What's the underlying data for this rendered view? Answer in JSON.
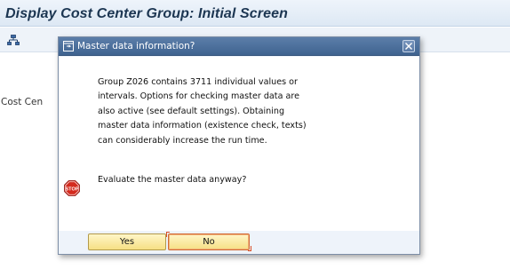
{
  "screen": {
    "title": "Display Cost Center Group: Initial Screen",
    "field_label_partial": "Cost Cen"
  },
  "toolbar": {
    "hierarchy_icon": "hierarchy-icon"
  },
  "dialog": {
    "title": "Master data information?",
    "message_lines": [
      "Group Z026 contains 3711 individual values or",
      "intervals. Options for checking master data are",
      "also active (see default settings). Obtaining",
      "master data information (existence check, texts)",
      "can considerably increase the run time."
    ],
    "question": "Evaluate the master data anyway?",
    "stop_icon_label": "STOP",
    "buttons": {
      "yes": "Yes",
      "no": "No"
    }
  },
  "colors": {
    "header_blue": "#4a6e9c",
    "button_yellow": "#f6df84",
    "stop_red": "#d42a1e",
    "focus_orange": "#d84c25"
  }
}
